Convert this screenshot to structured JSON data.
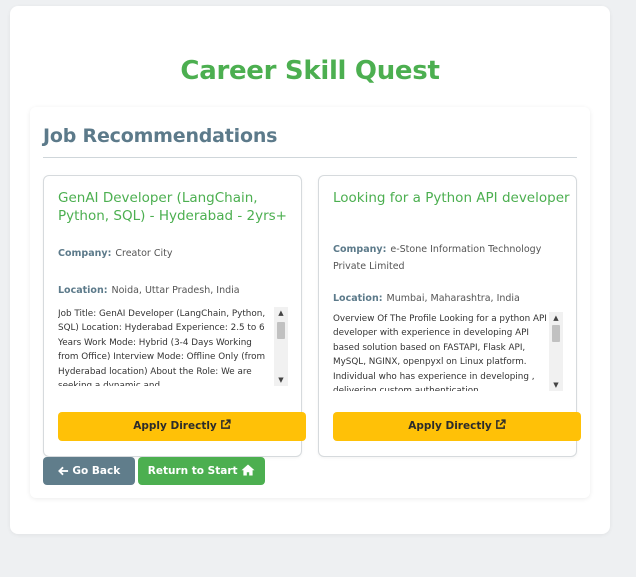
{
  "app": {
    "title": "Career Skill Quest"
  },
  "section": {
    "title": "Job Recommendations"
  },
  "labels": {
    "company": "Company:",
    "location": "Location:"
  },
  "jobs": [
    {
      "title": "GenAI Developer (LangChain, Python, SQL) - Hyderabad - 2yrs+",
      "company": "Creator City",
      "location": "Noida, Uttar Pradesh, India",
      "description": "Job Title: GenAI Developer (LangChain, Python, SQL) Location: Hyderabad Experience: 2.5 to 6 Years Work Mode: Hybrid (3-4 Days Working from Office) Interview Mode: Offline Only (from Hyderabad location) About the Role: We are seeking a dynamic and",
      "apply_label": "Apply Directly"
    },
    {
      "title": "Looking for a Python API developer",
      "company": "e-Stone Information Technology Private Limited",
      "location": "Mumbai, Maharashtra, India",
      "description": "Overview Of The Profile Looking for a python API developer with experience in developing API based solution based on FASTAPI, Flask API, MySQL, NGINX, openpyxl on Linux platform. Individual who has experience in developing , delivering custom authentication",
      "apply_label": "Apply Directly"
    }
  ],
  "actions": {
    "back_label": "Go Back",
    "start_label": "Return to Start"
  },
  "colors": {
    "brand_green": "#4caf50",
    "heading_slate": "#5c7a8a",
    "apply_yellow": "#ffc107",
    "back_slate": "#607d8b",
    "page_bg": "#eef0f2"
  },
  "icons": {
    "apply": "external-link-icon",
    "back": "arrow-left-icon",
    "start": "home-icon"
  }
}
